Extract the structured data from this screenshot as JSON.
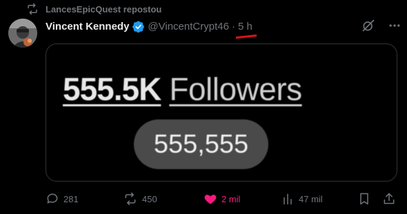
{
  "repost": {
    "text": "LancesEpicQuest repostou"
  },
  "author": {
    "name": "Vincent Kennedy",
    "handle": "@VincentCrypt46",
    "separator": "·",
    "time": "5 h"
  },
  "media": {
    "headline_number": "555.5K",
    "headline_label": "Followers",
    "pill_value": "555,555"
  },
  "actions": {
    "replies": "281",
    "reposts": "450",
    "likes": "2 mil",
    "views": "47 mil"
  },
  "colors": {
    "background": "#000000",
    "muted": "#71767b",
    "like": "#f91880",
    "verified": "#1d9bf0",
    "annotation": "#e0101a"
  }
}
